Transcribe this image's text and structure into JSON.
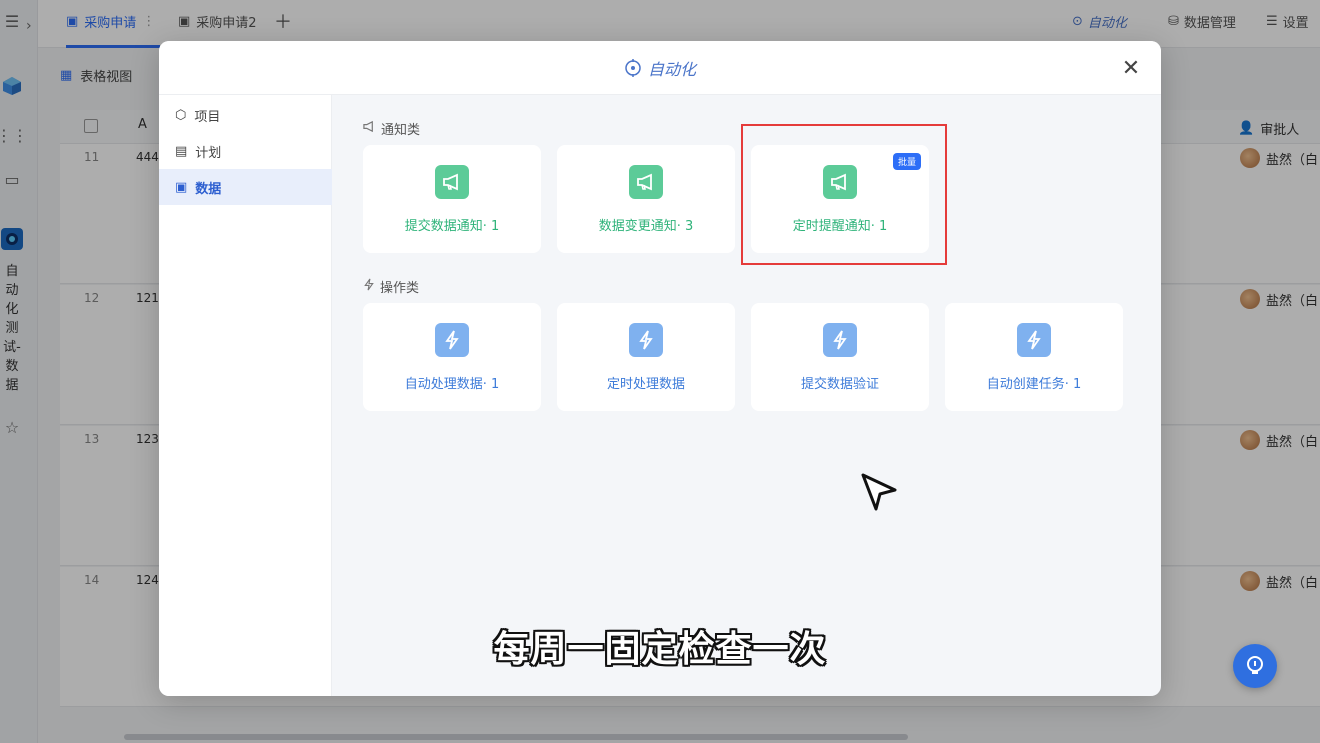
{
  "tabs": [
    {
      "label": "采购申请"
    },
    {
      "label": "采购申请2"
    }
  ],
  "toolbar": {
    "automation_label": "自动化",
    "data_manage_label": "数据管理",
    "settings_label": "设置"
  },
  "view": {
    "label": "表格视图"
  },
  "left_rail": {
    "app_name": "自动化测试-数据"
  },
  "grid": {
    "approver_header": "审批人",
    "rows": [
      {
        "num": "11",
        "value": "444",
        "approver": "盐然（白"
      },
      {
        "num": "12",
        "value": "121",
        "approver": "盐然（白"
      },
      {
        "num": "13",
        "value": "123",
        "approver": "盐然（白"
      },
      {
        "num": "14",
        "value": "124",
        "approver": "盐然（白"
      }
    ]
  },
  "modal": {
    "title": "自动化",
    "side_items": [
      {
        "label": "项目",
        "icon": "cube-icon"
      },
      {
        "label": "计划",
        "icon": "calendar-icon"
      },
      {
        "label": "数据",
        "icon": "document-icon"
      }
    ],
    "sections": [
      {
        "label": "通知类",
        "cards": [
          {
            "label": "提交数据通知· 1"
          },
          {
            "label": "数据变更通知· 3"
          },
          {
            "label": "定时提醒通知· 1",
            "badge": "批量"
          }
        ]
      },
      {
        "label": "操作类",
        "cards": [
          {
            "label": "自动处理数据· 1"
          },
          {
            "label": "定时处理数据"
          },
          {
            "label": "提交数据验证"
          },
          {
            "label": "自动创建任务· 1"
          }
        ]
      }
    ]
  },
  "subtitle": "每周一固定检查一次",
  "colors": {
    "accent": "#2d6ef7",
    "notify_green": "#5ccb98",
    "action_blue": "#7fb1ef",
    "highlight_red": "#e53b3b"
  }
}
